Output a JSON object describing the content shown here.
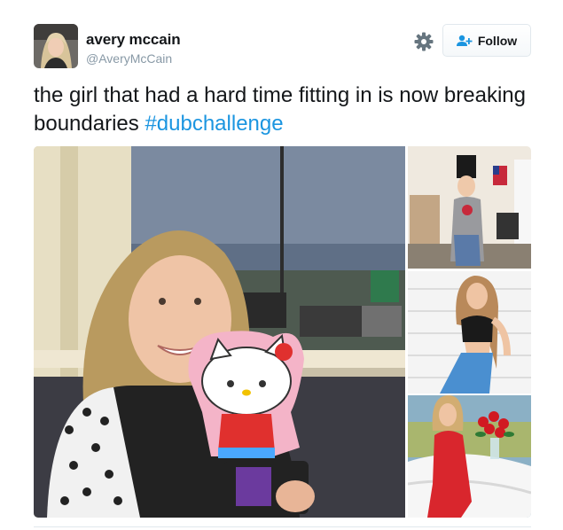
{
  "user": {
    "name": "avery mccain",
    "handle": "@AveryMcCain"
  },
  "actions": {
    "follow_label": "Follow",
    "settings_icon": "gear-icon",
    "follow_icon": "add-user-icon"
  },
  "tweet": {
    "text": "the girl that had a hard time fitting in is now breaking boundaries ",
    "hashtag": "#dubchallenge"
  },
  "colors": {
    "link": "#1b95e0",
    "handle": "#8899a6",
    "text": "#14171a",
    "border": "#e1e8ed"
  },
  "media": {
    "count": 4
  }
}
